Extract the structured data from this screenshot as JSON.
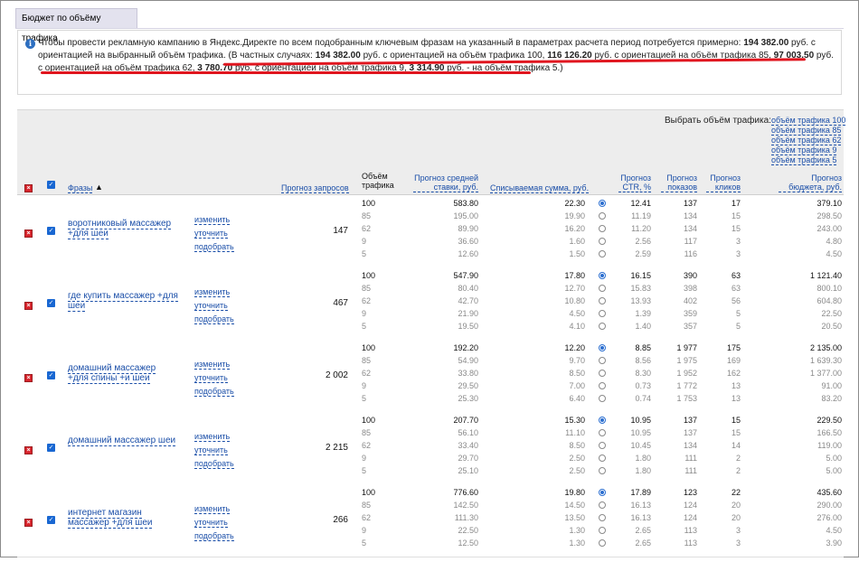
{
  "tab_title": "Бюджет по объёму трафика",
  "info": {
    "p1": "Чтобы провести рекламную кампанию в Яндекс.Директе по всем подобранным ключевым фразам на указанный в параметрах расчета период потребуется примерно: ",
    "total": "194 382.00",
    "p2": " руб. с ориентацией на выбранный объём трафика. ",
    "p3": "(В частных случаях: ",
    "v100": "194 382.00",
    "p4": " руб. с ориентацией на объём трафика 100, ",
    "v85": "116 126.20",
    "p5": " руб. с ориентацией на объём трафика 85, ",
    "v62": "97 003.50",
    "p6": " руб. с ориентацией на объём трафика 62, ",
    "v9": "3 780.70",
    "p7": " руб. с ориентацией на объём трафика 9, ",
    "v5": "3 314.90",
    "p8": " руб. - на объём трафика 5.)"
  },
  "traffic_title": "Выбрать объём трафика:",
  "traffic_links": [
    "объём трафика 100",
    "объём трафика 85",
    "объём трафика 62",
    "объём трафика 9",
    "объём трафика 5"
  ],
  "headers": {
    "phrases": "Фразы",
    "sort_arrow": "▲",
    "forecast": "Прогноз запросов",
    "volume": "Объём трафика",
    "bid": "Прогноз средней ставки, руб.",
    "charge": "Списываемая сумма, руб.",
    "ctr": "Прогноз CTR, %",
    "shows": "Прогноз показов",
    "clicks": "Прогноз кликов",
    "budget": "Прогноз бюджета, руб."
  },
  "actions": [
    "изменить",
    "уточнить",
    "подобрать"
  ],
  "rows": [
    {
      "phrase": "воротниковый массажер +для шеи",
      "forecast": "147",
      "lines": [
        {
          "vol": "100",
          "bid": "583.80",
          "charge": "22.30",
          "ctr": "12.41",
          "shows": "137",
          "clicks": "17",
          "budget": "379.10"
        },
        {
          "vol": "85",
          "bid": "195.00",
          "charge": "19.90",
          "ctr": "11.19",
          "shows": "134",
          "clicks": "15",
          "budget": "298.50"
        },
        {
          "vol": "62",
          "bid": "89.90",
          "charge": "16.20",
          "ctr": "11.20",
          "shows": "134",
          "clicks": "15",
          "budget": "243.00"
        },
        {
          "vol": "9",
          "bid": "36.60",
          "charge": "1.60",
          "ctr": "2.56",
          "shows": "117",
          "clicks": "3",
          "budget": "4.80"
        },
        {
          "vol": "5",
          "bid": "12.60",
          "charge": "1.50",
          "ctr": "2.59",
          "shows": "116",
          "clicks": "3",
          "budget": "4.50"
        }
      ]
    },
    {
      "phrase": "где купить массажер +для шеи",
      "forecast": "467",
      "lines": [
        {
          "vol": "100",
          "bid": "547.90",
          "charge": "17.80",
          "ctr": "16.15",
          "shows": "390",
          "clicks": "63",
          "budget": "1 121.40"
        },
        {
          "vol": "85",
          "bid": "80.40",
          "charge": "12.70",
          "ctr": "15.83",
          "shows": "398",
          "clicks": "63",
          "budget": "800.10"
        },
        {
          "vol": "62",
          "bid": "42.70",
          "charge": "10.80",
          "ctr": "13.93",
          "shows": "402",
          "clicks": "56",
          "budget": "604.80"
        },
        {
          "vol": "9",
          "bid": "21.90",
          "charge": "4.50",
          "ctr": "1.39",
          "shows": "359",
          "clicks": "5",
          "budget": "22.50"
        },
        {
          "vol": "5",
          "bid": "19.50",
          "charge": "4.10",
          "ctr": "1.40",
          "shows": "357",
          "clicks": "5",
          "budget": "20.50"
        }
      ]
    },
    {
      "phrase": "домашний массажер +для спины +и шеи",
      "forecast": "2 002",
      "lines": [
        {
          "vol": "100",
          "bid": "192.20",
          "charge": "12.20",
          "ctr": "8.85",
          "shows": "1 977",
          "clicks": "175",
          "budget": "2 135.00"
        },
        {
          "vol": "85",
          "bid": "54.90",
          "charge": "9.70",
          "ctr": "8.56",
          "shows": "1 975",
          "clicks": "169",
          "budget": "1 639.30"
        },
        {
          "vol": "62",
          "bid": "33.80",
          "charge": "8.50",
          "ctr": "8.30",
          "shows": "1 952",
          "clicks": "162",
          "budget": "1 377.00"
        },
        {
          "vol": "9",
          "bid": "29.50",
          "charge": "7.00",
          "ctr": "0.73",
          "shows": "1 772",
          "clicks": "13",
          "budget": "91.00"
        },
        {
          "vol": "5",
          "bid": "25.30",
          "charge": "6.40",
          "ctr": "0.74",
          "shows": "1 753",
          "clicks": "13",
          "budget": "83.20"
        }
      ]
    },
    {
      "phrase": "домашний массажер шеи",
      "forecast": "2 215",
      "lines": [
        {
          "vol": "100",
          "bid": "207.70",
          "charge": "15.30",
          "ctr": "10.95",
          "shows": "137",
          "clicks": "15",
          "budget": "229.50"
        },
        {
          "vol": "85",
          "bid": "56.10",
          "charge": "11.10",
          "ctr": "10.95",
          "shows": "137",
          "clicks": "15",
          "budget": "166.50"
        },
        {
          "vol": "62",
          "bid": "33.40",
          "charge": "8.50",
          "ctr": "10.45",
          "shows": "134",
          "clicks": "14",
          "budget": "119.00"
        },
        {
          "vol": "9",
          "bid": "29.70",
          "charge": "2.50",
          "ctr": "1.80",
          "shows": "111",
          "clicks": "2",
          "budget": "5.00"
        },
        {
          "vol": "5",
          "bid": "25.10",
          "charge": "2.50",
          "ctr": "1.80",
          "shows": "111",
          "clicks": "2",
          "budget": "5.00"
        }
      ]
    },
    {
      "phrase": "интернет магазин массажер +для шеи",
      "forecast": "266",
      "lines": [
        {
          "vol": "100",
          "bid": "776.60",
          "charge": "19.80",
          "ctr": "17.89",
          "shows": "123",
          "clicks": "22",
          "budget": "435.60"
        },
        {
          "vol": "85",
          "bid": "142.50",
          "charge": "14.50",
          "ctr": "16.13",
          "shows": "124",
          "clicks": "20",
          "budget": "290.00"
        },
        {
          "vol": "62",
          "bid": "111.30",
          "charge": "13.50",
          "ctr": "16.13",
          "shows": "124",
          "clicks": "20",
          "budget": "276.00"
        },
        {
          "vol": "9",
          "bid": "22.50",
          "charge": "1.30",
          "ctr": "2.65",
          "shows": "113",
          "clicks": "3",
          "budget": "4.50"
        },
        {
          "vol": "5",
          "bid": "12.50",
          "charge": "1.30",
          "ctr": "2.65",
          "shows": "113",
          "clicks": "3",
          "budget": "3.90"
        }
      ]
    }
  ]
}
